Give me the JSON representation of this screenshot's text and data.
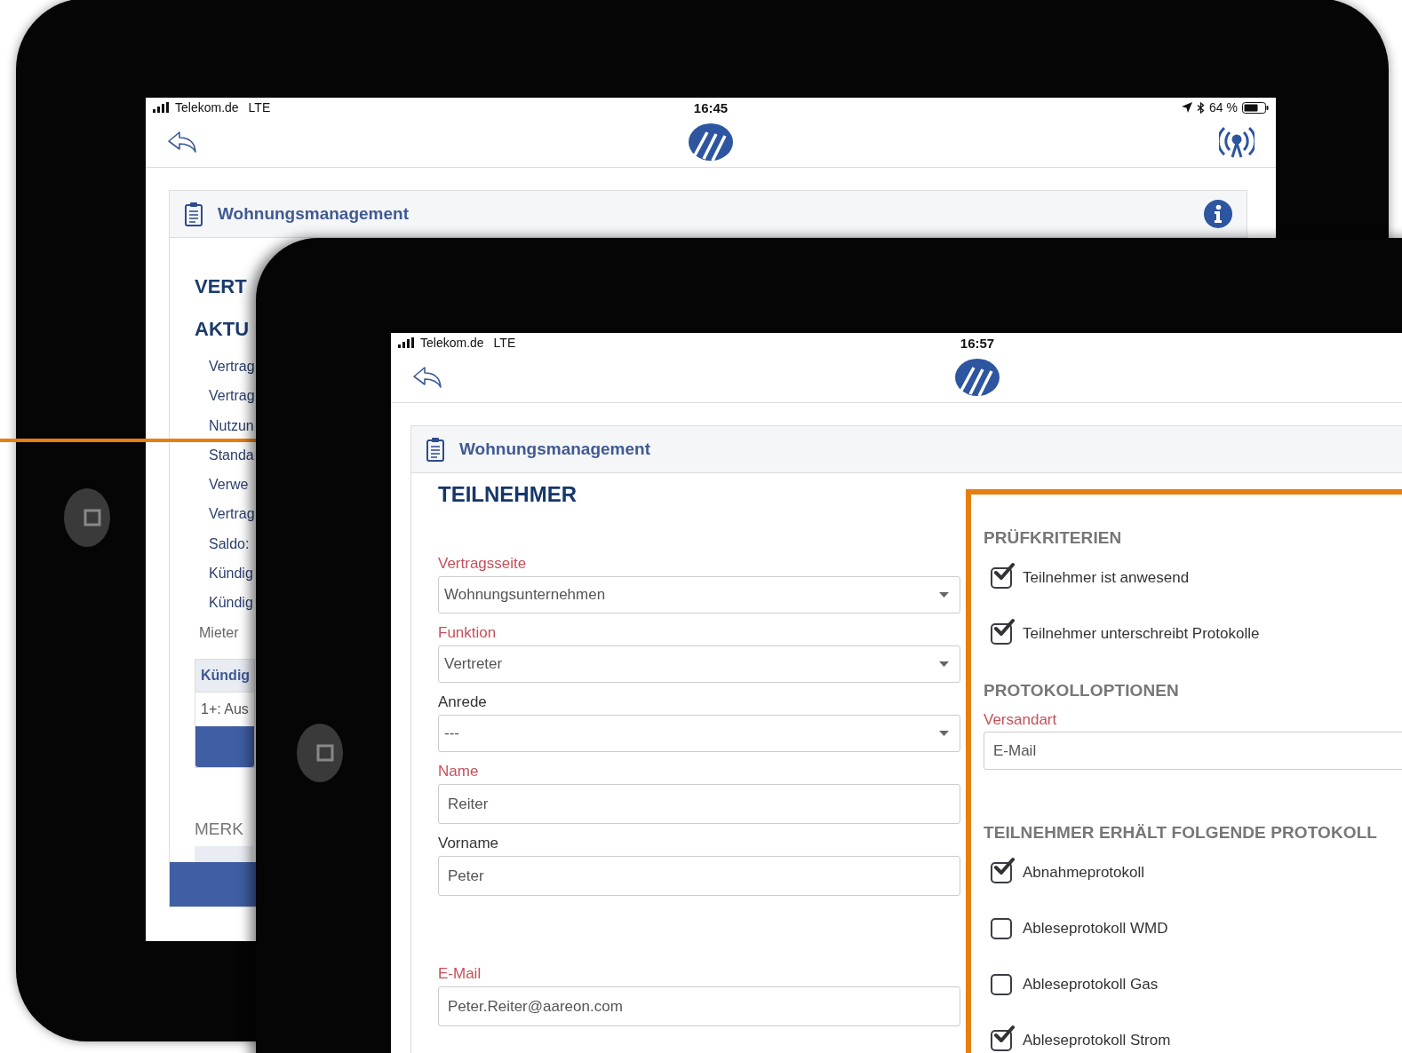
{
  "back_screen": {
    "status_bar": {
      "carrier": "Telekom.de",
      "network": "LTE",
      "time": "16:45",
      "battery": "64 %"
    },
    "panel": {
      "title": "Wohnungsmanagement"
    },
    "headings": [
      "VERT",
      "AKTU"
    ],
    "fields": [
      "Vertrag",
      "Vertrag",
      "Nutzun",
      "Standa",
      "Verwe",
      "Vertrag",
      "Saldo:",
      "Kündig",
      "Kündig"
    ],
    "group_label": "Mieter",
    "table": {
      "columns": [
        "Kündig"
      ],
      "rows": [
        [
          "1+: Aus"
        ]
      ]
    },
    "section_heading": "MERK"
  },
  "front_screen": {
    "status_bar": {
      "carrier": "Telekom.de",
      "network": "LTE",
      "time": "16:57"
    },
    "panel": {
      "title": "Wohnungsmanagement"
    },
    "heading": "TEILNEHMER",
    "form": [
      {
        "kind": "select",
        "label": "Vertragsseite",
        "required": true,
        "value": "Wohnungsunternehmen"
      },
      {
        "kind": "select",
        "label": "Funktion",
        "required": true,
        "value": "Vertreter"
      },
      {
        "kind": "select",
        "label": "Anrede",
        "required": false,
        "value": "---"
      },
      {
        "kind": "text",
        "label": "Name",
        "required": true,
        "value": "Reiter"
      },
      {
        "kind": "text",
        "label": "Vorname",
        "required": false,
        "value": "Peter"
      },
      {
        "kind": "text",
        "label": "E-Mail",
        "required": true,
        "value": "Peter.Reiter@aareon.com"
      }
    ],
    "criteria": {
      "title": "PRÜFKRITERIEN",
      "items": [
        {
          "label": "Teilnehmer ist anwesend",
          "checked": true
        },
        {
          "label": "Teilnehmer unterschreibt Protokolle",
          "checked": true
        }
      ]
    },
    "options": {
      "title": "PROTOKOLLOPTIONEN",
      "fields": [
        {
          "kind": "text",
          "label": "Versandart",
          "required": true,
          "value": "E-Mail"
        }
      ]
    },
    "protocols": {
      "title": "TEILNEHMER ERHÄLT FOLGENDE PROTOKOLL",
      "items": [
        {
          "label": "Abnahmeprotokoll",
          "checked": true
        },
        {
          "label": "Ableseprotokoll WMD",
          "checked": false
        },
        {
          "label": "Ableseprotokoll Gas",
          "checked": false
        },
        {
          "label": "Ableseprotokoll Strom",
          "checked": true
        }
      ]
    }
  }
}
